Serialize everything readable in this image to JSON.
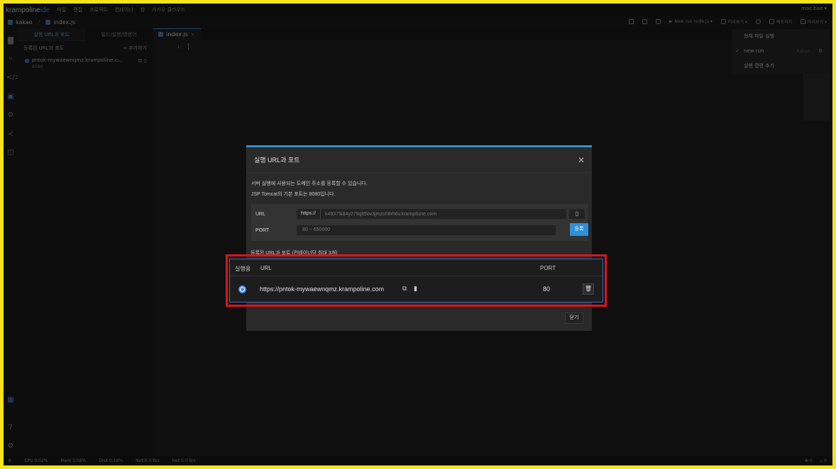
{
  "app": {
    "logo": "krampoline",
    "logo_ide": "ide",
    "user": "mac.bae ▾"
  },
  "menu": [
    "파일",
    "편집",
    "프로젝트",
    "컨테이너",
    "창",
    "카카오 클라우드"
  ],
  "breadcrumb": {
    "project": "kakao",
    "file": "index.js"
  },
  "toolbar": {
    "run_target": "New run node.js ▾",
    "preview": "미리보기 ▾",
    "deploy": "배포하기",
    "preview2": "미리보기 ▾"
  },
  "sidebar": {
    "tabs": [
      "실행 URL과 포트",
      "빌드/실행/명령어"
    ],
    "header": "등록된 URL과 포트",
    "add": "+ 추가하기",
    "entry_url": "pntok-mywaewnqmz.krampoline.c...",
    "entry_port": "8080"
  },
  "editor": {
    "tab": "index.js",
    "line": "1"
  },
  "run_menu": {
    "current": "현재 파일 실행",
    "new_run": "new run",
    "new_run_tag": "Kakao",
    "add": "실행 명령 추가"
  },
  "status": {
    "cpu": "CPU 0.02%",
    "mem": "Mem 3.58%",
    "disk": "Disk 0.16%",
    "net_r": "Net R 0 B/s",
    "net_s": "Net S 0 B/s",
    "errors": "0",
    "warnings": "0"
  },
  "modal": {
    "title": "실행 URL과 포트",
    "desc1": "서버 실행에 사용되는 도메인 주소를 등록할 수 있습니다.",
    "desc2": "JSP Tomcat의 기본 포트는 8080입니다.",
    "url_label": "URL",
    "url_prefix": "https://",
    "url_value": "k49375i84y279qlt5ov3jmzo58rh6v.krampilune.com",
    "port_label": "PORT",
    "port_placeholder": "80 ~ 650000",
    "register_button": "등록",
    "registered_caption": "등록된 URL과 포트 (컨테이너당 최대 3개)",
    "table_headers": {
      "run": "실행용",
      "url": "URL",
      "port": "PORT"
    },
    "row": {
      "url": "https://pntok-mywaewnqmz.krampoline.com",
      "port": "80"
    },
    "close_button": "닫기"
  },
  "colors": {
    "accent": "#2f8fd8",
    "highlight": "#e0131a",
    "frame": "#f5e41b"
  },
  "icons": [
    "copy-icon",
    "external-link-icon",
    "trash-icon",
    "close-icon",
    "check-icon",
    "gear-icon"
  ]
}
